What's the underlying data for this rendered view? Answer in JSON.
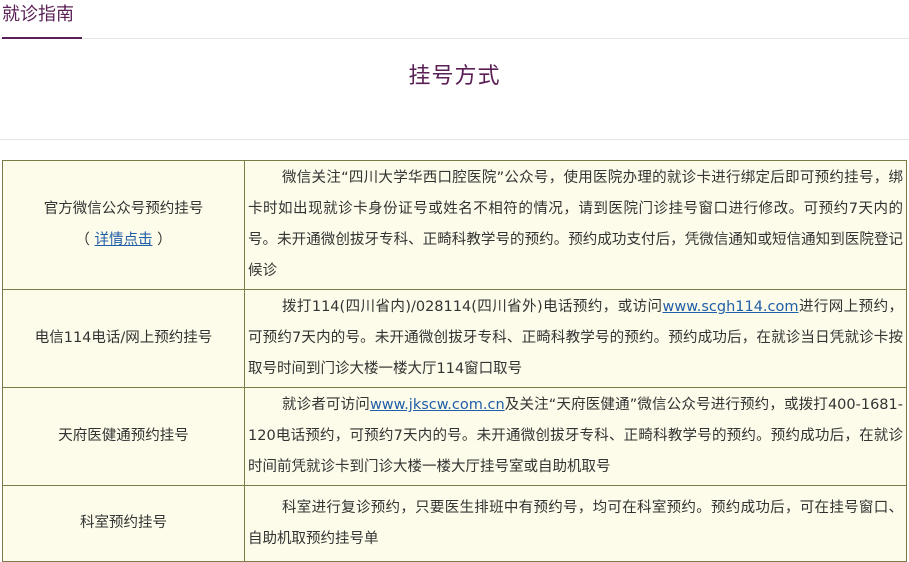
{
  "tabs": {
    "active_label": "就诊指南"
  },
  "page": {
    "title": "挂号方式"
  },
  "table": {
    "rows": [
      {
        "method": "官方微信公众号预约挂号",
        "detail_open": "（ ",
        "detail_link": "详情点击",
        "detail_close": " ）",
        "desc_text": "微信关注“四川大学华西口腔医院”公众号，使用医院办理的就诊卡进行绑定后即可预约挂号，绑卡时如出现就诊卡身份证号或姓名不相符的情况，请到医院门诊挂号窗口进行修改。可预约7天内的号。未开通微创拔牙专科、正畸科教学号的预约。预约成功支付后，凭微信通知或短信通知到医院登记候诊"
      },
      {
        "method": "电信114电话/网上预约挂号",
        "desc_before": "拨打114(四川省内)/028114(四川省外)电话预约，或访问",
        "desc_link": "www.scgh114.com",
        "desc_after": "进行网上预约，可预约7天内的号。未开通微创拔牙专科、正畸科教学号的预约。预约成功后，在就诊当日凭就诊卡按取号时间到门诊大楼一楼大厅114窗口取号"
      },
      {
        "method": "天府医健通预约挂号",
        "desc_before": "就诊者可访问",
        "desc_link": "www.jkscw.com.cn",
        "desc_after": "及关注“天府医健通”微信公众号进行预约，或拨打400-1681-120电话预约，可预约7天内的号。未开通微创拔牙专科、正畸科教学号的预约。预约成功后，在就诊时间前凭就诊卡到门诊大楼一楼大厅挂号室或自助机取号"
      },
      {
        "method": "科室预约挂号",
        "desc_text": "科室进行复诊预约，只要医生排班中有预约号，均可在科室预约。预约成功后，可在挂号窗口、自助机取预约挂号单"
      }
    ]
  },
  "colors": {
    "brand": "#5a1f55",
    "table_bg": "#fdfbe9",
    "table_border": "#7b7b47",
    "link": "#1f5ea8"
  }
}
